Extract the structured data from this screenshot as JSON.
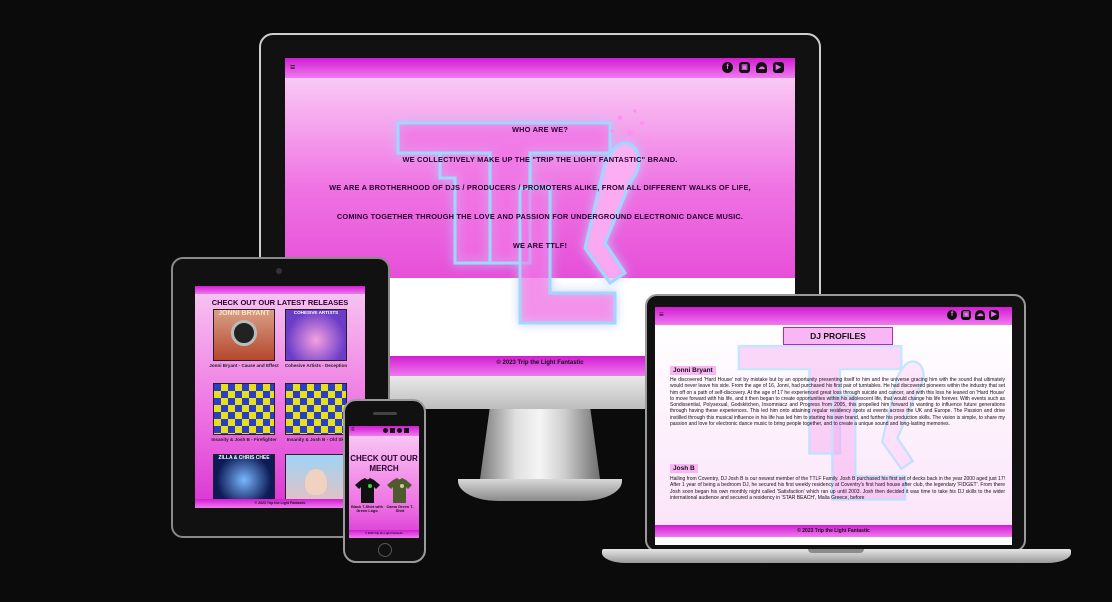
{
  "monitor": {
    "social_icons": [
      "facebook-icon",
      "twitch-icon",
      "soundcloud-icon",
      "youtube-icon"
    ],
    "menu_icon": "≡",
    "heading": "WHO ARE WE?",
    "lines": [
      "WE COLLECTIVELY MAKE UP THE \"TRIP THE LIGHT FANTASTIC\" BRAND.",
      "WE ARE A BROTHERHOOD OF DJS / PRODUCERS / PROMOTERS ALIKE, FROM ALL DIFFERENT WALKS OF LIFE,",
      "COMING TOGETHER THROUGH THE LOVE AND PASSION FOR UNDERGROUND ELECTRONIC DANCE MUSIC.",
      "WE ARE TTLF!"
    ],
    "footer": "© 2023 Trip the Light Fantastic"
  },
  "tablet": {
    "title": "CHECK OUT OUR LATEST RELEASES",
    "albums": [
      {
        "cover_text": "JONNI BRYANT",
        "caption": "Jonni Bryant - Cause and Effect"
      },
      {
        "cover_text": "COHESIVE ARTISTS",
        "caption": "Cohesive Artists - Deception"
      },
      {
        "cover_text": "",
        "caption": "Insanity & Josh B - Firefighter"
      },
      {
        "cover_text": "",
        "caption": "Insanity & Josh B - Old Skl"
      },
      {
        "cover_text": "ZILLA & CHRIS CHEE",
        "caption": ""
      },
      {
        "cover_text": "",
        "caption": ""
      }
    ],
    "footer": "© 2023 Trip the Light Fantastic"
  },
  "phone": {
    "title": "CHECK OUT OUR MERCH",
    "shirts": [
      {
        "caption": "Black T-Shirt with Green Logo",
        "color": "#111111"
      },
      {
        "caption": "Camo Green T-Shirt",
        "color": "#4f5a2e"
      }
    ],
    "footer": "© 2023 Trip the Light Fantastic"
  },
  "laptop": {
    "heading": "DJ PROFILES",
    "profiles": [
      {
        "name": "Jonni Bryant",
        "bio": "He discovered 'Hard House' not by mistake but by an opportunity presenting itself to him and the universe gracing him with the sound that ultimately would never leave his side. From the age of 16, Jonni, had purchased his first pair of turntables. He had discovered pioneers within the industry that set him off on a path of self-discovery. At the age of 17 he experienced great loss through suicide and cancer, and with this loss he leaned on 'Hard House' to move forward with his life, and it then began to create opportunities within his adolescent life, that would change his life forever. With events such as Sondissential, Polysexual, Godskitchen, Insomniacz and Progress from 2005, this propelled him forward to wanting to influence future generations through having these experiences. This led him onto attaining regular residency spots at events across the UK and Europe. The Passion and drive instilled through this musical influence in his life has led him to starting his own brand, and further his production skills. The vision is simple, to share my passion and love for electronic dance music to bring people together, and to create a unique sound and long-lasting memories."
      },
      {
        "name": "Josh B",
        "bio": "Hailing from Coventry, DJ Josh B is our newest member of the TTLF Family. Josh B purchased his first set of decks back in the year 2000 aged just 17! After 1 year of being a bedroom DJ, he secured his first weekly residency at Coventry's first hard house after club, the legendary 'FIDGET'. From there Josh soon began his own monthly night called 'Satisfaction' which ran up until 2003. Josh then decided it was time to take his DJ skills to the wider international audience and secured a residency in 'STAR BEACH', Malia Greece, before"
      }
    ],
    "footer": "© 2023 Trip the Light Fantastic"
  },
  "colors": {
    "background": "#0b0b0b",
    "brand_pink": "#e64fd8",
    "brand_magenta": "#d21cd2",
    "text_dark": "#2a0030"
  }
}
